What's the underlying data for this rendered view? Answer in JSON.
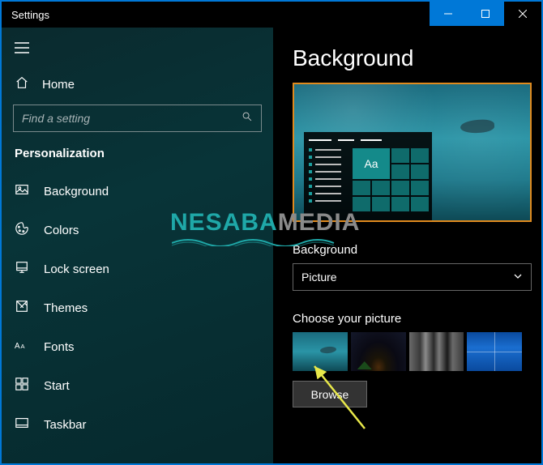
{
  "window": {
    "title": "Settings"
  },
  "sidebar": {
    "home": "Home",
    "search_placeholder": "Find a setting",
    "section": "Personalization",
    "items": [
      {
        "label": "Background"
      },
      {
        "label": "Colors"
      },
      {
        "label": "Lock screen"
      },
      {
        "label": "Themes"
      },
      {
        "label": "Fonts"
      },
      {
        "label": "Start"
      },
      {
        "label": "Taskbar"
      }
    ]
  },
  "content": {
    "title": "Background",
    "preview_sample_text": "Aa",
    "dropdown_label": "Background",
    "dropdown_value": "Picture",
    "choose_label": "Choose your picture",
    "browse_label": "Browse"
  },
  "watermark": {
    "part1": "NESABA",
    "part2": "MEDIA"
  },
  "colors": {
    "accent": "#0078d7",
    "annotation": "#e08a1e",
    "arrow": "#e8e84a"
  }
}
